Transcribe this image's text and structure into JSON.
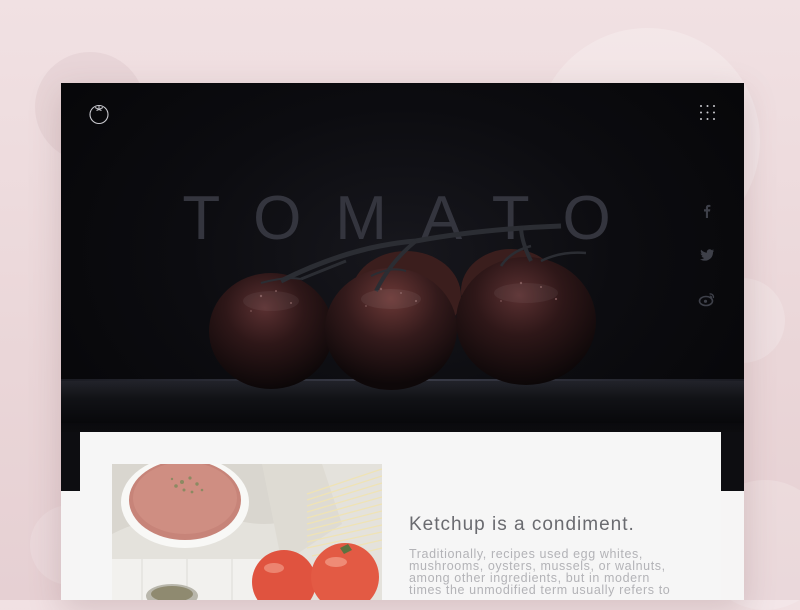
{
  "hero": {
    "title": "TOMATO"
  },
  "icons": {
    "logo": "tomato-outline-icon",
    "menu": "grid-dots-icon",
    "social": [
      "facebook-icon",
      "twitter-icon",
      "weibo-icon"
    ]
  },
  "article": {
    "heading": "Ketchup is a condiment.",
    "body_lines": [
      "Traditionally, recipes used egg whites,",
      "mushrooms, oysters, mussels, or walnuts,",
      "among other ingredients, but in modern",
      "times the unmodified term usually refers to"
    ]
  },
  "colors": {
    "background": "#ecdadc",
    "hero": "#0b0b0f",
    "title": "#34353e",
    "heading": "#6a6b70",
    "body": "#b3b3b7"
  }
}
